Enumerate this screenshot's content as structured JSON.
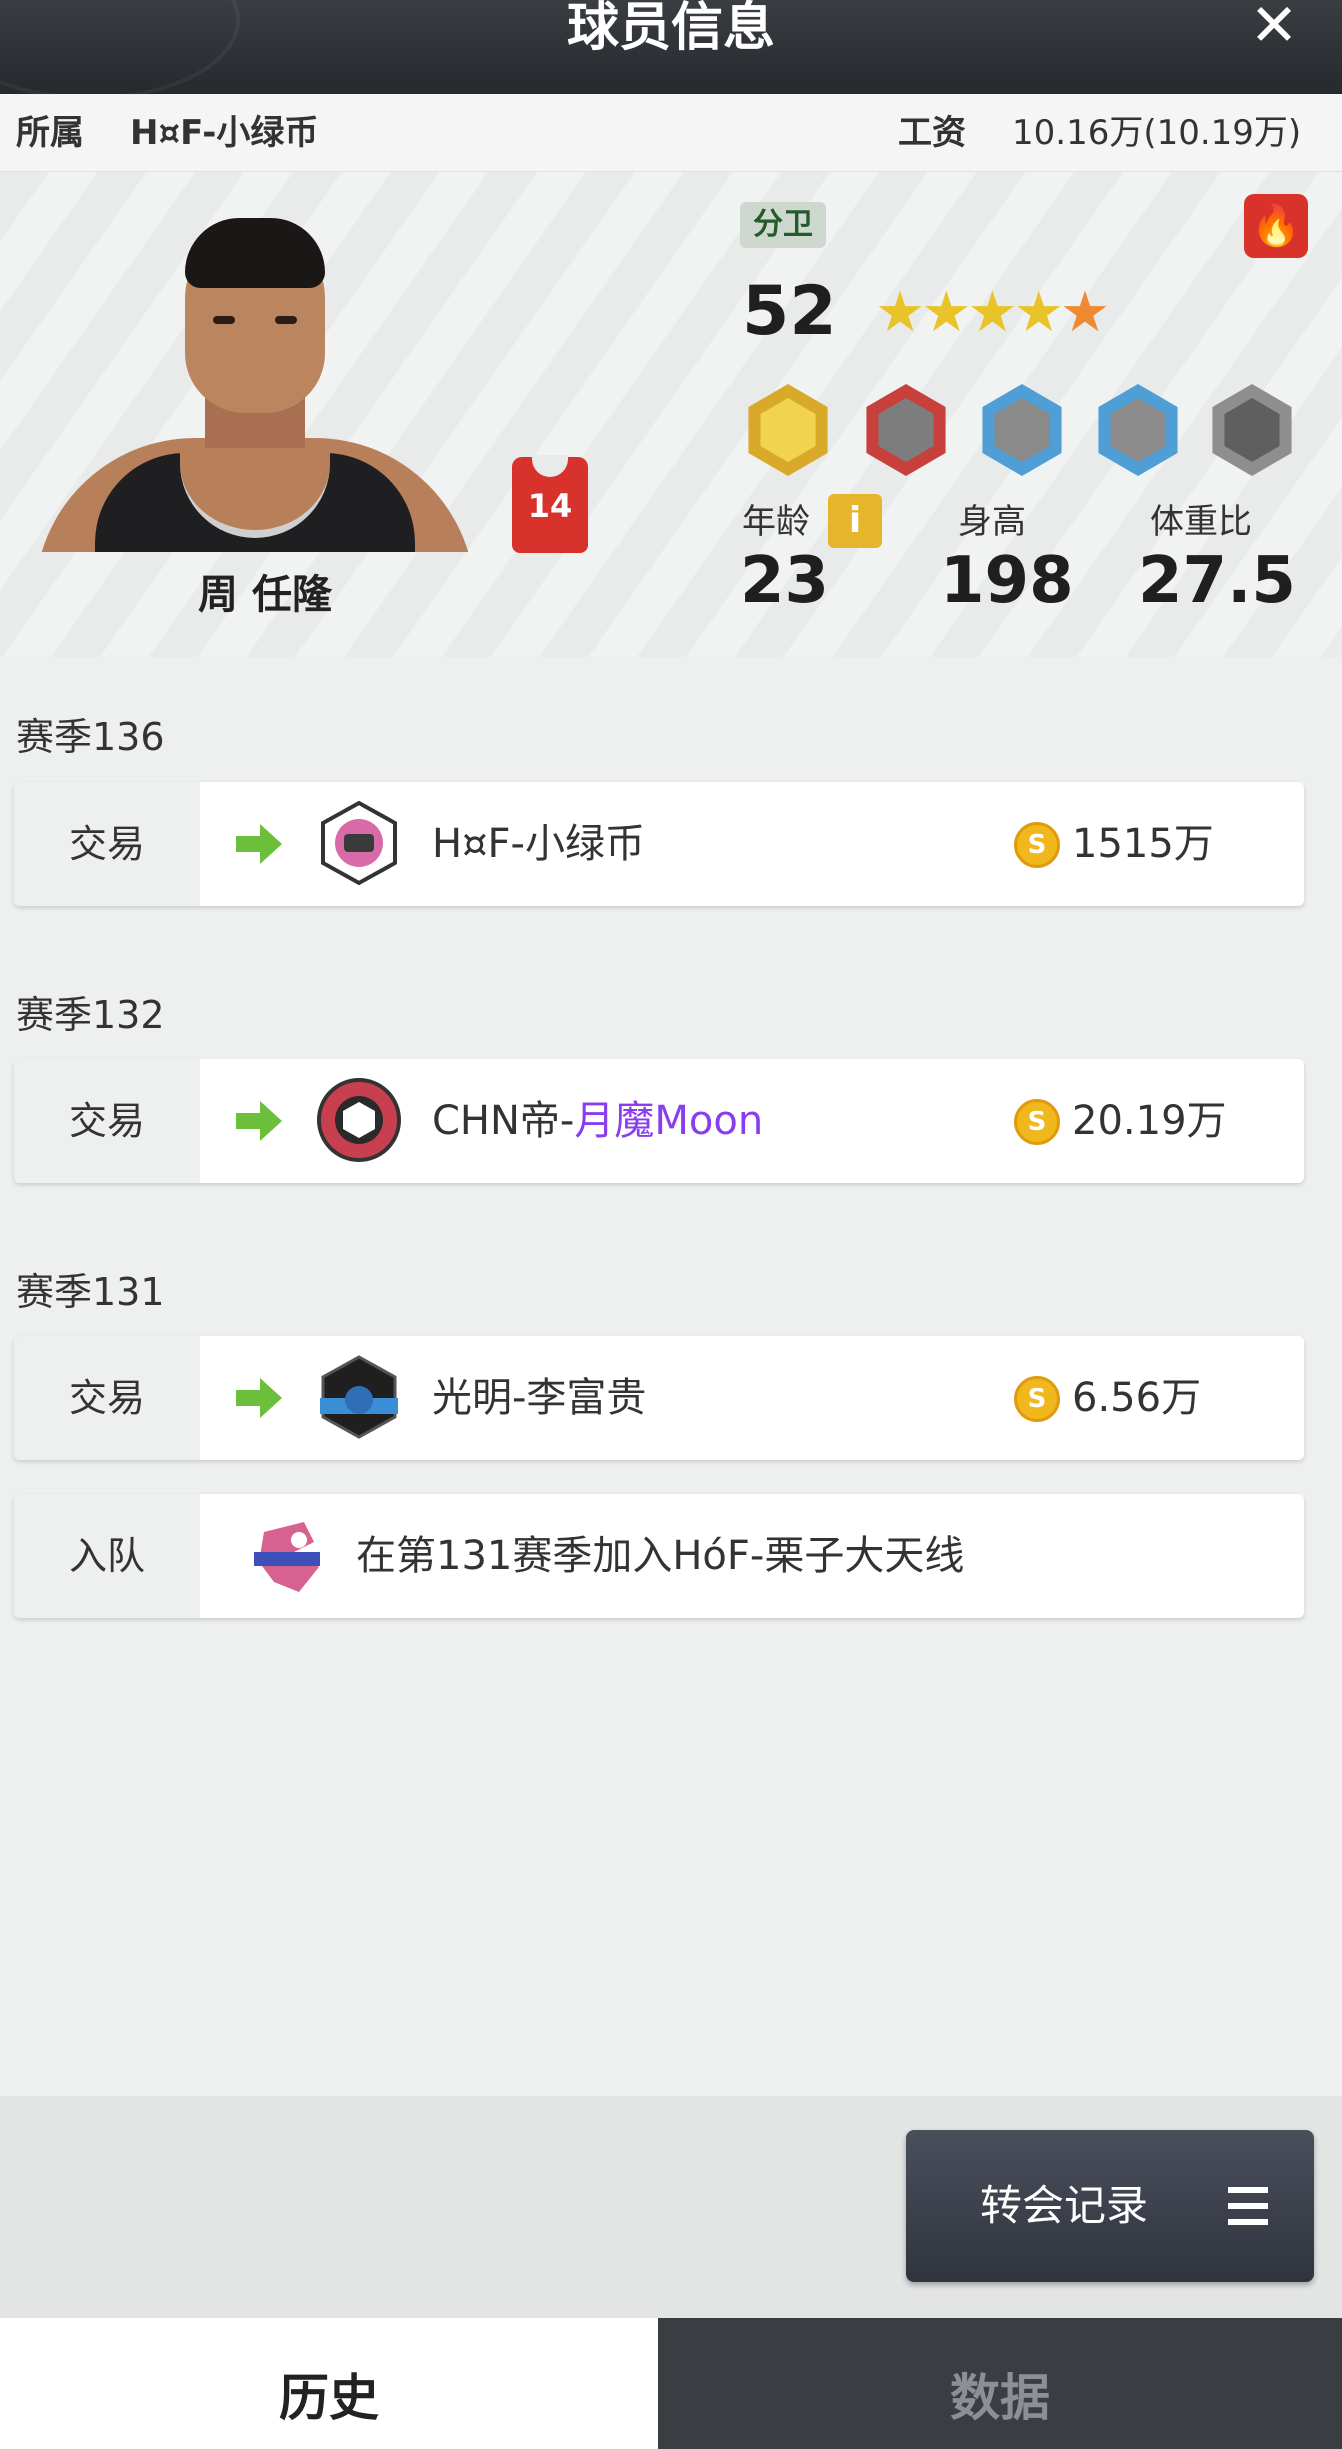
{
  "header": {
    "title": "球员信息",
    "close_icon": "close-icon"
  },
  "team_bar": {
    "team_label": "所属",
    "team_name": "H¤F-小绿币",
    "salary_label": "工资",
    "salary_value": "10.16万(10.19万)"
  },
  "player": {
    "name": "周 任隆",
    "jersey_number": "14",
    "position": "分卫",
    "rating": "52",
    "stars": 5,
    "age_label": "年龄",
    "age": "23",
    "height_label": "身高",
    "height": "198",
    "weight_ratio_label": "体重比",
    "weight_ratio": "27.5",
    "info_icon": "i",
    "badges": [
      "gold-player-badge",
      "red-skull-badge",
      "blue-head-badge",
      "blue-net-badge",
      "gray-empty-badge"
    ]
  },
  "history": [
    {
      "season": "赛季136",
      "entries": [
        {
          "type": "交易",
          "team": "H¤F-小绿币",
          "team_highlight": "",
          "price": "1515万"
        }
      ]
    },
    {
      "season": "赛季132",
      "entries": [
        {
          "type": "交易",
          "team": "CHN帝-",
          "team_highlight": "月魔Moon",
          "price": "20.19万"
        }
      ]
    },
    {
      "season": "赛季131",
      "entries": [
        {
          "type": "交易",
          "team": "光明-李富贵",
          "team_highlight": "",
          "price": "6.56万"
        },
        {
          "type": "入队",
          "text": "在第131赛季加入HóF-栗子大天线"
        }
      ]
    }
  ],
  "coin_glyph": "S",
  "transfer_button": {
    "label": "转会记录"
  },
  "tabs": [
    {
      "label": "历史",
      "active": true
    },
    {
      "label": "数据",
      "active": false
    }
  ],
  "colors": {
    "accent_green": "#6bbf3a",
    "highlight_purple": "#8a3df0",
    "coin_gold": "#f0b81c",
    "fire_red": "#d9322b"
  }
}
